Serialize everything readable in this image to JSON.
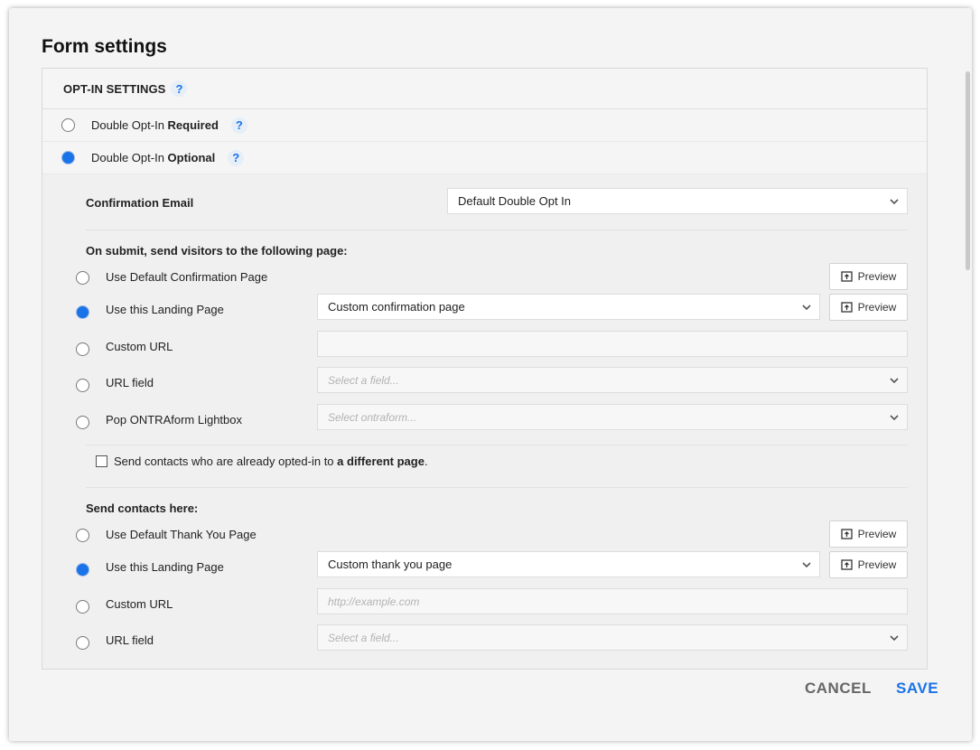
{
  "title": "Form settings",
  "optin_section": {
    "heading": "OPT-IN SETTINGS",
    "help": "?",
    "options": [
      {
        "prefix": "Double Opt-In ",
        "emphasis": "Required",
        "selected": false,
        "help": "?"
      },
      {
        "prefix": "Double Opt-In ",
        "emphasis": "Optional",
        "selected": true,
        "help": "?"
      }
    ]
  },
  "confirmation_email": {
    "label": "Confirmation Email",
    "value": "Default Double Opt In"
  },
  "on_submit": {
    "heading": "On submit, send visitors to the following page:",
    "default_label": "Use Default Confirmation Page",
    "landing_label": "Use this Landing Page",
    "landing_value": "Custom confirmation page",
    "custom_url_label": "Custom URL",
    "custom_url_value": "",
    "url_field_label": "URL field",
    "url_field_placeholder": "Select a field...",
    "lightbox_label": "Pop ONTRAform Lightbox",
    "lightbox_placeholder": "Select ontraform...",
    "selected": "landing"
  },
  "already_opted": {
    "text_prefix": "Send contacts who are already opted-in to ",
    "text_bold": "a different page",
    "text_suffix": ".",
    "checked": false
  },
  "send_contacts": {
    "heading": "Send contacts here:",
    "default_label": "Use Default Thank You Page",
    "landing_label": "Use this Landing Page",
    "landing_value": "Custom thank you page",
    "custom_url_label": "Custom URL",
    "custom_url_placeholder": "http://example.com",
    "url_field_label": "URL field",
    "url_field_placeholder": "Select a field...",
    "selected": "landing"
  },
  "preview_label": "Preview",
  "footer": {
    "cancel": "CANCEL",
    "save": "SAVE"
  },
  "colors": {
    "accent": "#1a73e8",
    "cancel": "#666666",
    "save": "#1a73e8"
  }
}
